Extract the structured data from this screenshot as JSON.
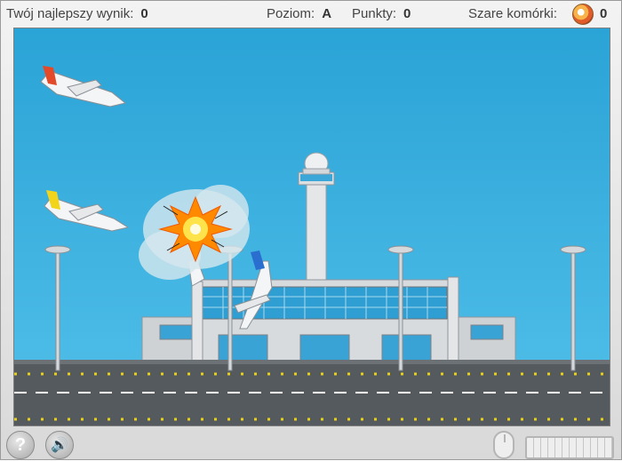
{
  "status": {
    "best_label": "Twój najlepszy wynik:",
    "best_value": "0",
    "level_label": "Poziom:",
    "level_value": "A",
    "points_label": "Punkty:",
    "points_value": "0",
    "cells_label": "Szare komórki:",
    "cells_value": "0"
  },
  "icons": {
    "brain": "brain-icon",
    "help": "help-icon",
    "sound": "speaker-icon",
    "mouse": "mouse-icon",
    "keyboard": "keyboard-icon"
  },
  "controls": {
    "help_glyph": "?",
    "sound_glyph": "🔊"
  },
  "colors": {
    "sky": "#2aa3d6",
    "runway": "#555a5f",
    "explosion": "#ff8a00"
  }
}
